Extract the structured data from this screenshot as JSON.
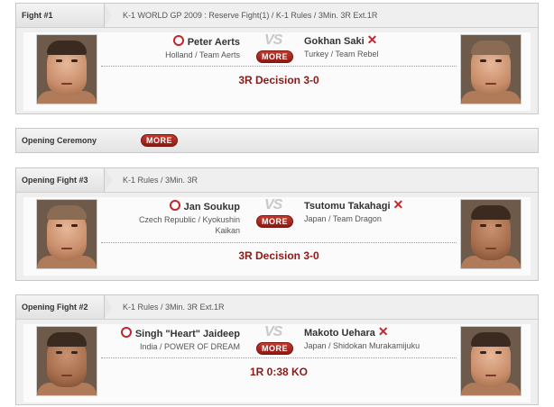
{
  "fights": [
    {
      "label": "Fight #1",
      "info": "K-1 WORLD GP 2009 : Reserve Fight(1) / K-1 Rules / 3Min. 3R Ext.1R",
      "winner": {
        "name": "Peter Aerts",
        "team": "Holland / Team Aerts"
      },
      "loser": {
        "name": "Gokhan Saki",
        "team": "Turkey / Team Rebel"
      },
      "vs": "VS",
      "more": "MORE",
      "result": "3R Decision 3-0"
    },
    {
      "label": "Opening Fight #3",
      "info": "K-1 Rules / 3Min. 3R",
      "winner": {
        "name": "Jan Soukup",
        "team": "Czech Republic / Kyokushin Kaikan"
      },
      "loser": {
        "name": "Tsutomu Takahagi",
        "team": "Japan / Team Dragon"
      },
      "vs": "VS",
      "more": "MORE",
      "result": "3R Decision 3-0"
    },
    {
      "label": "Opening Fight #2",
      "info": "K-1 Rules / 3Min. 3R Ext.1R",
      "winner": {
        "name": "Singh \"Heart\" Jaideep",
        "team": "India / POWER OF DREAM"
      },
      "loser": {
        "name": "Makoto Uehara",
        "team": "Japan / Shidokan Murakamijuku"
      },
      "vs": "VS",
      "more": "MORE",
      "result": "1R 0:38 KO"
    }
  ],
  "ceremony": {
    "label": "Opening Ceremony",
    "more": "MORE"
  },
  "colors": {
    "accent": "#c0262b",
    "result": "#8b1a16",
    "panel": "#efefef"
  }
}
